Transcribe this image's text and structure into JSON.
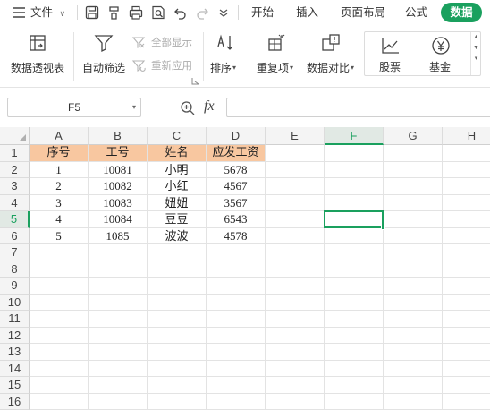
{
  "topbar": {
    "menu_label": "文件",
    "tabs": [
      "开始",
      "插入",
      "页面布局",
      "公式",
      "数据"
    ],
    "active_tab": "数据",
    "accent": "#1aa05e"
  },
  "ribbon": {
    "pivot": "数据透视表",
    "autofilter": "自动筛选",
    "show_all": "全部显示",
    "reapply": "重新应用",
    "sort": "排序",
    "duplicates": "重复项",
    "compare": "数据对比",
    "stock": "股票",
    "fund": "基金"
  },
  "formula": {
    "cell_ref": "F5",
    "fx": "fx"
  },
  "sheet": {
    "columns": [
      "A",
      "B",
      "C",
      "D",
      "E",
      "F",
      "G",
      "H"
    ],
    "rows": [
      "1",
      "2",
      "3",
      "4",
      "5",
      "6",
      "7",
      "8",
      "9",
      "10",
      "11",
      "12",
      "13",
      "14",
      "15",
      "16"
    ],
    "selected_col": "F",
    "selected_row": "5",
    "header_fill": "#f8c7a0",
    "table": [
      [
        "序号",
        "工号",
        "姓名",
        "应发工资"
      ],
      [
        "1",
        "10081",
        "小明",
        "5678"
      ],
      [
        "2",
        "10082",
        "小红",
        "4567"
      ],
      [
        "3",
        "10083",
        "妞妞",
        "3567"
      ],
      [
        "4",
        "10084",
        "豆豆",
        "6543"
      ],
      [
        "5",
        "1085",
        "波波",
        "4578"
      ]
    ]
  }
}
